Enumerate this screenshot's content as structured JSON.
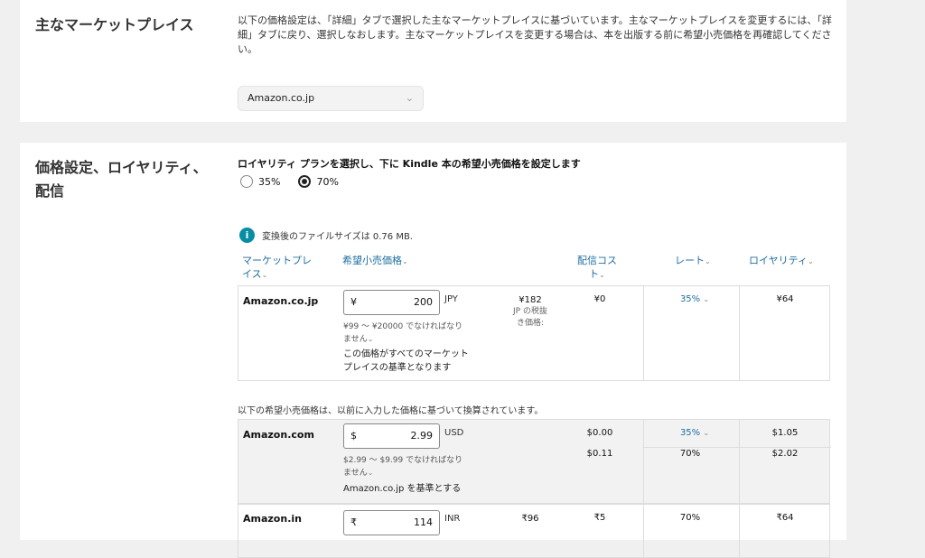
{
  "marketplace_section": {
    "title": "主なマーケットプレイス",
    "description": "以下の価格設定は、「詳細」タブで選択した主なマーケットプレイスに基づいています。主なマーケットプレイスを変更するには、「詳細」タブに戻り、選択しなおします。主なマーケットプレイスを変更する場合は、本を出版する前に希望小売価格を再確認してください。",
    "selected": "Amazon.co.jp",
    "chevron_icon": "chevron-down-icon"
  },
  "pricing_section": {
    "title_line1": "価格設定、ロイヤリティ、",
    "title_line2": "配信",
    "royalty_prompt": "ロイヤリティ プランを選択し、下に Kindle 本の希望小売価格を設定します",
    "options": [
      {
        "label": "35%",
        "selected": false
      },
      {
        "label": "70%",
        "selected": true
      }
    ],
    "file_size_note": "変換後のファイルサイズは 0.76 MB.",
    "headers": {
      "marketplace_line1": "マーケットプレ",
      "marketplace_line2": "イス",
      "list_price": "希望小売価格",
      "delivery_cost_line1": "配信コス",
      "delivery_cost_line2": "ト",
      "rate": "レート",
      "royalty": "ロイヤリティ"
    },
    "conversion_note": "以下の希望小売価格は、以前に入力した価格に基づいて換算されています。",
    "rows": [
      {
        "marketplace": "Amazon.co.jp",
        "currency_symbol": "¥",
        "price": "200",
        "currency_code": "JPY",
        "range_note_line1": "¥99 ～ ¥20000 でなければなり",
        "range_note_line2": "ません",
        "base_note_line1": "この価格がすべてのマーケット",
        "base_note_line2": "プレイスの基準となります",
        "tax_value": "¥182",
        "tax_label_line1": "JP の税抜",
        "tax_label_line2": "き価格:",
        "delivery_cost": "¥0",
        "rate": "35%",
        "royalty": "¥64"
      },
      {
        "marketplace": "Amazon.com",
        "currency_symbol": "$",
        "price": "2.99",
        "currency_code": "USD",
        "range_note_line1": "$2.99 ～ $9.99 でなければなり",
        "range_note_line2": "ません",
        "base_note": "Amazon.co.jp を基準とする",
        "delivery_cost_35": "$0.00",
        "delivery_cost_70": "$0.11",
        "rate_35": "35%",
        "rate_70": "70%",
        "royalty_35": "$1.05",
        "royalty_70": "$2.02"
      },
      {
        "marketplace": "Amazon.in",
        "currency_symbol": "₹",
        "price": "114",
        "currency_code": "INR",
        "tax_value": "₹96",
        "delivery_cost": "₹5",
        "rate": "70%",
        "royalty": "₹64"
      }
    ]
  }
}
